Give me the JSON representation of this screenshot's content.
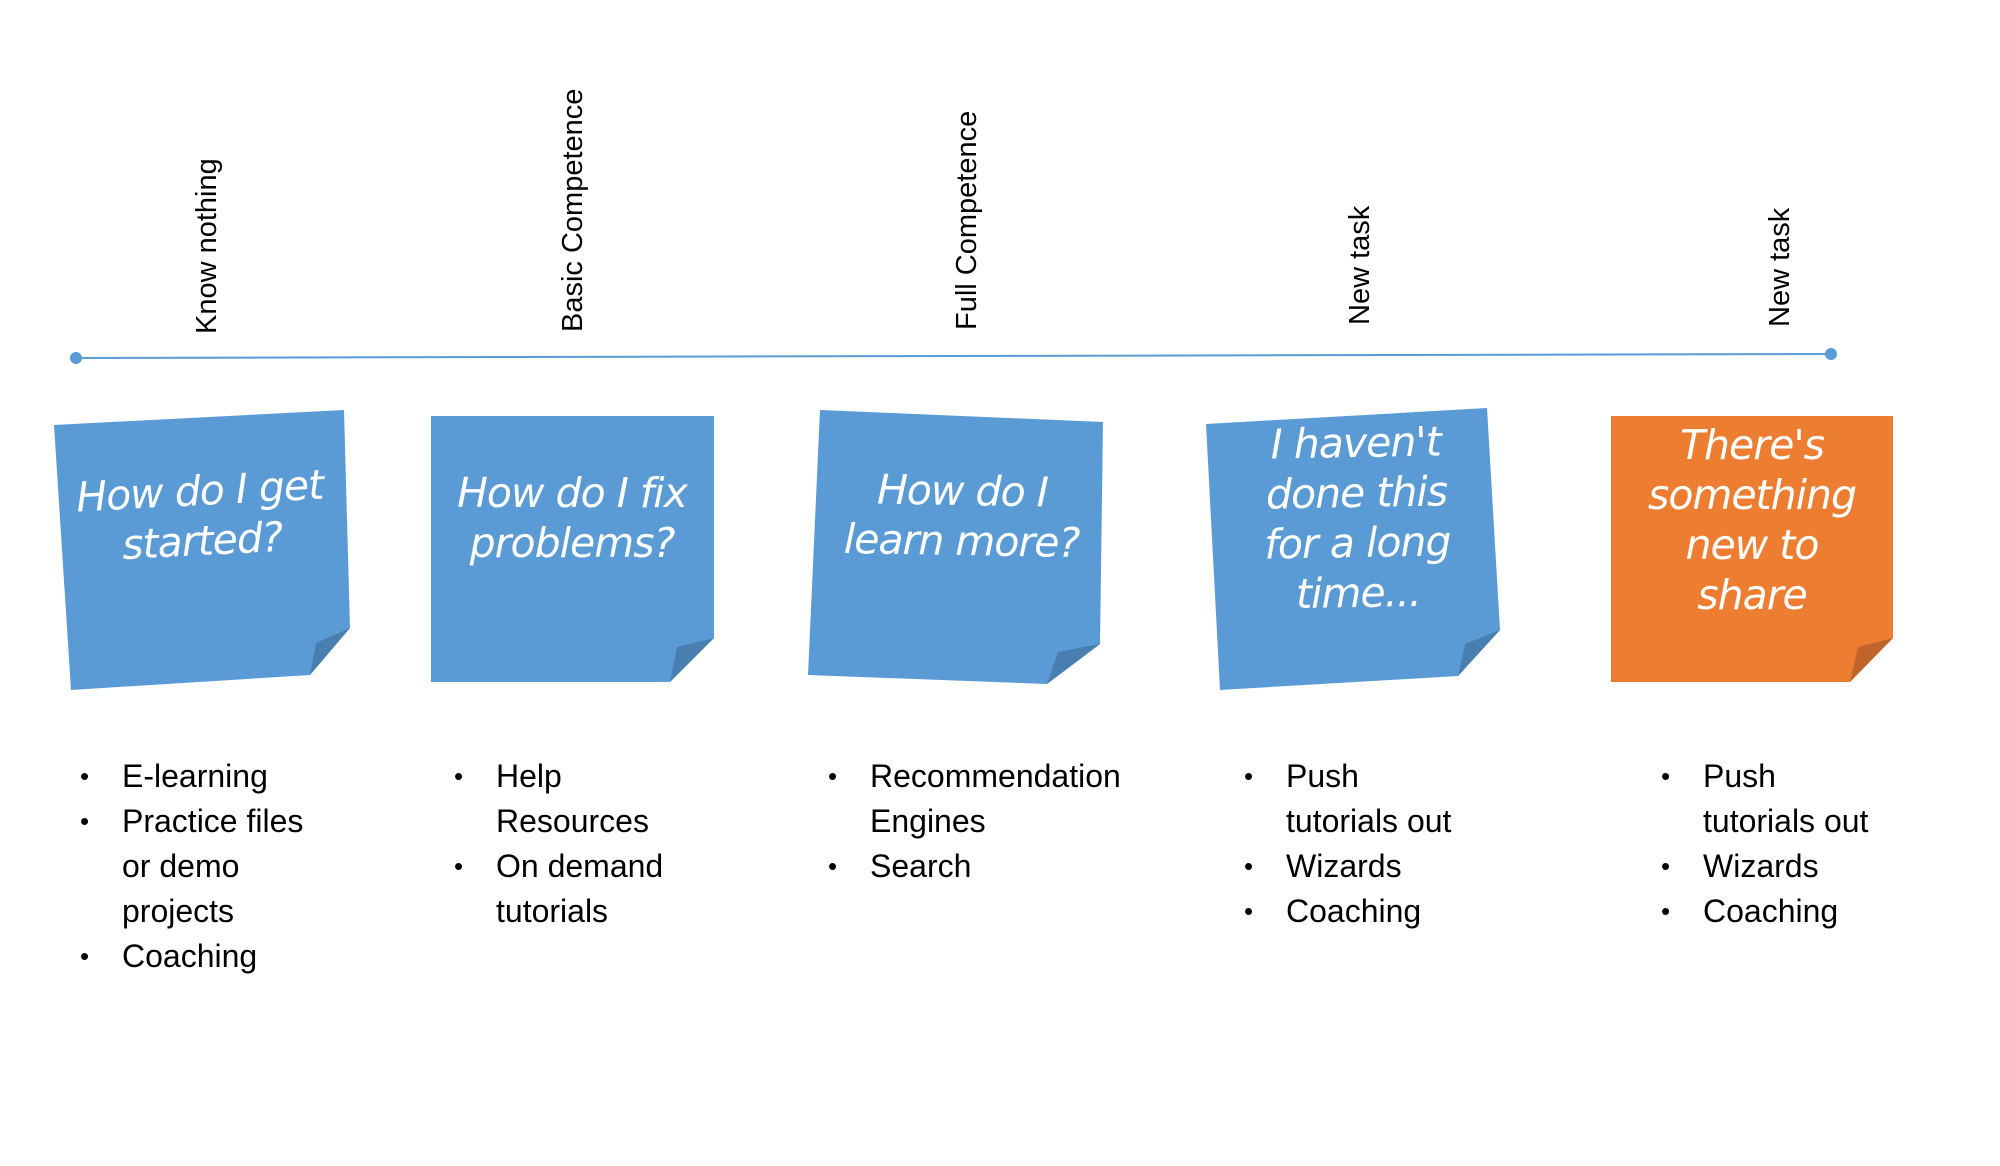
{
  "stages": [
    {
      "label": "Know nothing"
    },
    {
      "label": "Basic Competence"
    },
    {
      "label": "Full Competence"
    },
    {
      "label": "New task"
    },
    {
      "label": "New task"
    }
  ],
  "notes": [
    {
      "text": "How do I get\nstarted?",
      "color": "#5B9BD5",
      "fold_color": "#487FB0"
    },
    {
      "text": "How do I fix\nproblems?",
      "color": "#5B9BD5",
      "fold_color": "#487FB0"
    },
    {
      "text": "How do I\nlearn more?",
      "color": "#5B9BD5",
      "fold_color": "#487FB0"
    },
    {
      "text": "I haven't\ndone this\nfor a long\ntime...",
      "color": "#5B9BD5",
      "fold_color": "#487FB0"
    },
    {
      "text": "There's\nsomething\nnew to\nshare",
      "color": "#ED7D31",
      "fold_color": "#C0652A"
    }
  ],
  "lists": [
    {
      "items": [
        "E-learning",
        "Practice files\nor demo\nprojects",
        "Coaching"
      ]
    },
    {
      "items": [
        "Help\nResources",
        "On demand\ntutorials"
      ]
    },
    {
      "items": [
        "Recommendation\nEngines",
        "Search"
      ]
    },
    {
      "items": [
        "Push\ntutorials out",
        "Wizards",
        "Coaching"
      ]
    },
    {
      "items": [
        "Push\ntutorials out",
        "Wizards",
        "Coaching"
      ]
    }
  ],
  "bullet_glyph": "•",
  "timeline_color": "#5B9BD5"
}
